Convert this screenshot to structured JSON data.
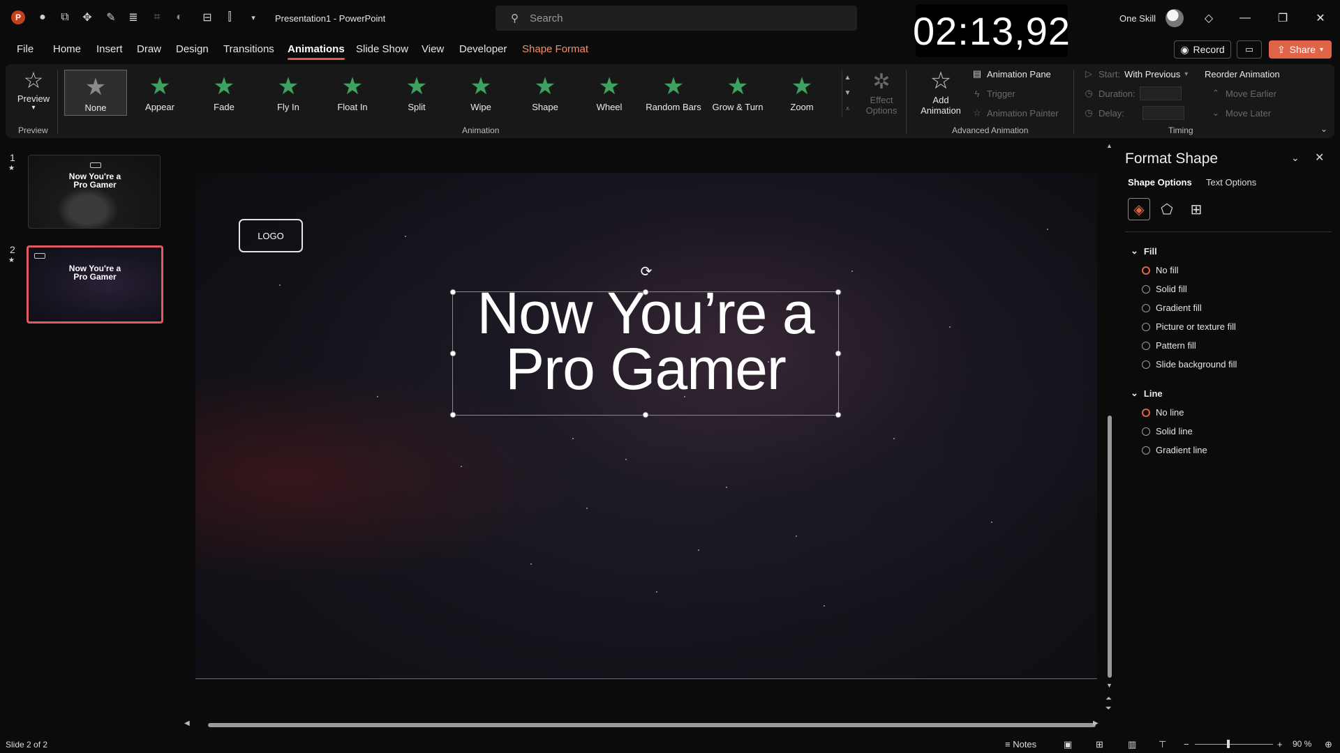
{
  "titlebar": {
    "document_title": "Presentation1  -  PowerPoint",
    "search_placeholder": "Search",
    "timer": "02:13,92",
    "user_name": "One Skill"
  },
  "tabs": [
    "File",
    "Home",
    "Insert",
    "Draw",
    "Design",
    "Transitions",
    "Animations",
    "Slide Show",
    "View",
    "Developer",
    "Shape Format"
  ],
  "active_tab": "Animations",
  "actions": {
    "record": "Record",
    "share": "Share"
  },
  "ribbon": {
    "preview_label": "Preview",
    "preview_group": "Preview",
    "animation_group": "Animation",
    "animations": [
      "None",
      "Appear",
      "Fade",
      "Fly In",
      "Float In",
      "Split",
      "Wipe",
      "Shape",
      "Wheel",
      "Random Bars",
      "Grow & Turn",
      "Zoom"
    ],
    "selected_animation": "None",
    "effect_options": "Effect Options",
    "add_animation": "Add Animation",
    "animation_pane": "Animation Pane",
    "trigger": "Trigger",
    "animation_painter": "Animation Painter",
    "advanced_group": "Advanced Animation",
    "start_label": "Start:",
    "start_value": "With Previous",
    "duration_label": "Duration:",
    "delay_label": "Delay:",
    "reorder": "Reorder Animation",
    "move_earlier": "Move Earlier",
    "move_later": "Move Later",
    "timing_group": "Timing"
  },
  "slides": [
    {
      "number": "1",
      "title": "Now You're a Pro Gamer"
    },
    {
      "number": "2",
      "title": "Now You're a Pro Gamer"
    }
  ],
  "current_slide": {
    "logo_text": "LOGO",
    "title_line1": "Now You’re a",
    "title_line2": "Pro Gamer"
  },
  "format_pane": {
    "title": "Format Shape",
    "tab_shape": "Shape Options",
    "tab_text": "Text Options",
    "fill_heading": "Fill",
    "fill_options": [
      "No fill",
      "Solid fill",
      "Gradient fill",
      "Picture or texture fill",
      "Pattern fill",
      "Slide background fill"
    ],
    "fill_selected": "No fill",
    "line_heading": "Line",
    "line_options": [
      "No line",
      "Solid line",
      "Gradient line"
    ],
    "line_selected": "No line"
  },
  "statusbar": {
    "slide_count": "Slide 2 of 2",
    "notes": "Notes",
    "zoom": "90 %"
  },
  "colors": {
    "accent": "#e0644a",
    "animation_star": "#3fa060"
  }
}
